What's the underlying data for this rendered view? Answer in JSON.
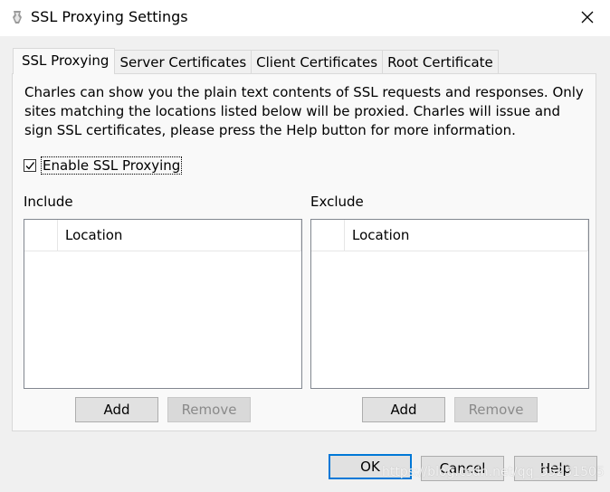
{
  "window": {
    "title": "SSL Proxying Settings",
    "close_glyph": "✕"
  },
  "tabs": [
    {
      "label": "SSL Proxying",
      "active": true
    },
    {
      "label": "Server Certificates",
      "active": false
    },
    {
      "label": "Client Certificates",
      "active": false
    },
    {
      "label": "Root Certificate",
      "active": false
    }
  ],
  "ssl_panel": {
    "description": "Charles can show you the plain text contents of SSL requests and responses. Only sites matching the locations listed below will be proxied. Charles will issue and sign SSL certificates, please press the Help button for more information.",
    "enable_checkbox": {
      "label": "Enable SSL Proxying",
      "checked": true
    },
    "include": {
      "label": "Include",
      "column_header": "Location",
      "rows": [],
      "add_label": "Add",
      "remove_label": "Remove"
    },
    "exclude": {
      "label": "Exclude",
      "column_header": "Location",
      "rows": [],
      "add_label": "Add",
      "remove_label": "Remove"
    }
  },
  "dialog_buttons": {
    "ok": "OK",
    "cancel": "Cancel",
    "help": "Help"
  },
  "watermark": "https://blog.csdn.net/qq_35231505",
  "colors": {
    "focus_border": "#0078d7",
    "disabled_text": "#8a8a8a"
  }
}
